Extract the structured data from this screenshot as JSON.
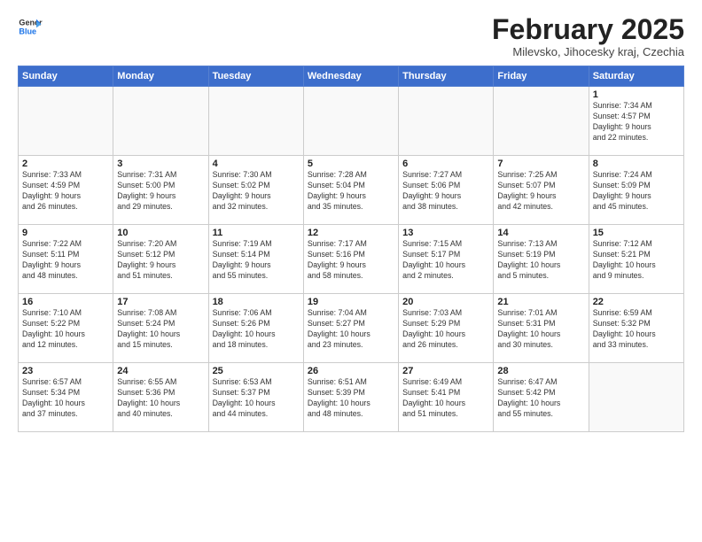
{
  "logo": {
    "line1": "General",
    "line2": "Blue"
  },
  "title": "February 2025",
  "subtitle": "Milevsko, Jihocesky kraj, Czechia",
  "weekdays": [
    "Sunday",
    "Monday",
    "Tuesday",
    "Wednesday",
    "Thursday",
    "Friday",
    "Saturday"
  ],
  "weeks": [
    [
      {
        "day": "",
        "info": ""
      },
      {
        "day": "",
        "info": ""
      },
      {
        "day": "",
        "info": ""
      },
      {
        "day": "",
        "info": ""
      },
      {
        "day": "",
        "info": ""
      },
      {
        "day": "",
        "info": ""
      },
      {
        "day": "1",
        "info": "Sunrise: 7:34 AM\nSunset: 4:57 PM\nDaylight: 9 hours\nand 22 minutes."
      }
    ],
    [
      {
        "day": "2",
        "info": "Sunrise: 7:33 AM\nSunset: 4:59 PM\nDaylight: 9 hours\nand 26 minutes."
      },
      {
        "day": "3",
        "info": "Sunrise: 7:31 AM\nSunset: 5:00 PM\nDaylight: 9 hours\nand 29 minutes."
      },
      {
        "day": "4",
        "info": "Sunrise: 7:30 AM\nSunset: 5:02 PM\nDaylight: 9 hours\nand 32 minutes."
      },
      {
        "day": "5",
        "info": "Sunrise: 7:28 AM\nSunset: 5:04 PM\nDaylight: 9 hours\nand 35 minutes."
      },
      {
        "day": "6",
        "info": "Sunrise: 7:27 AM\nSunset: 5:06 PM\nDaylight: 9 hours\nand 38 minutes."
      },
      {
        "day": "7",
        "info": "Sunrise: 7:25 AM\nSunset: 5:07 PM\nDaylight: 9 hours\nand 42 minutes."
      },
      {
        "day": "8",
        "info": "Sunrise: 7:24 AM\nSunset: 5:09 PM\nDaylight: 9 hours\nand 45 minutes."
      }
    ],
    [
      {
        "day": "9",
        "info": "Sunrise: 7:22 AM\nSunset: 5:11 PM\nDaylight: 9 hours\nand 48 minutes."
      },
      {
        "day": "10",
        "info": "Sunrise: 7:20 AM\nSunset: 5:12 PM\nDaylight: 9 hours\nand 51 minutes."
      },
      {
        "day": "11",
        "info": "Sunrise: 7:19 AM\nSunset: 5:14 PM\nDaylight: 9 hours\nand 55 minutes."
      },
      {
        "day": "12",
        "info": "Sunrise: 7:17 AM\nSunset: 5:16 PM\nDaylight: 9 hours\nand 58 minutes."
      },
      {
        "day": "13",
        "info": "Sunrise: 7:15 AM\nSunset: 5:17 PM\nDaylight: 10 hours\nand 2 minutes."
      },
      {
        "day": "14",
        "info": "Sunrise: 7:13 AM\nSunset: 5:19 PM\nDaylight: 10 hours\nand 5 minutes."
      },
      {
        "day": "15",
        "info": "Sunrise: 7:12 AM\nSunset: 5:21 PM\nDaylight: 10 hours\nand 9 minutes."
      }
    ],
    [
      {
        "day": "16",
        "info": "Sunrise: 7:10 AM\nSunset: 5:22 PM\nDaylight: 10 hours\nand 12 minutes."
      },
      {
        "day": "17",
        "info": "Sunrise: 7:08 AM\nSunset: 5:24 PM\nDaylight: 10 hours\nand 15 minutes."
      },
      {
        "day": "18",
        "info": "Sunrise: 7:06 AM\nSunset: 5:26 PM\nDaylight: 10 hours\nand 18 minutes."
      },
      {
        "day": "19",
        "info": "Sunrise: 7:04 AM\nSunset: 5:27 PM\nDaylight: 10 hours\nand 23 minutes."
      },
      {
        "day": "20",
        "info": "Sunrise: 7:03 AM\nSunset: 5:29 PM\nDaylight: 10 hours\nand 26 minutes."
      },
      {
        "day": "21",
        "info": "Sunrise: 7:01 AM\nSunset: 5:31 PM\nDaylight: 10 hours\nand 30 minutes."
      },
      {
        "day": "22",
        "info": "Sunrise: 6:59 AM\nSunset: 5:32 PM\nDaylight: 10 hours\nand 33 minutes."
      }
    ],
    [
      {
        "day": "23",
        "info": "Sunrise: 6:57 AM\nSunset: 5:34 PM\nDaylight: 10 hours\nand 37 minutes."
      },
      {
        "day": "24",
        "info": "Sunrise: 6:55 AM\nSunset: 5:36 PM\nDaylight: 10 hours\nand 40 minutes."
      },
      {
        "day": "25",
        "info": "Sunrise: 6:53 AM\nSunset: 5:37 PM\nDaylight: 10 hours\nand 44 minutes."
      },
      {
        "day": "26",
        "info": "Sunrise: 6:51 AM\nSunset: 5:39 PM\nDaylight: 10 hours\nand 48 minutes."
      },
      {
        "day": "27",
        "info": "Sunrise: 6:49 AM\nSunset: 5:41 PM\nDaylight: 10 hours\nand 51 minutes."
      },
      {
        "day": "28",
        "info": "Sunrise: 6:47 AM\nSunset: 5:42 PM\nDaylight: 10 hours\nand 55 minutes."
      },
      {
        "day": "",
        "info": ""
      }
    ]
  ]
}
